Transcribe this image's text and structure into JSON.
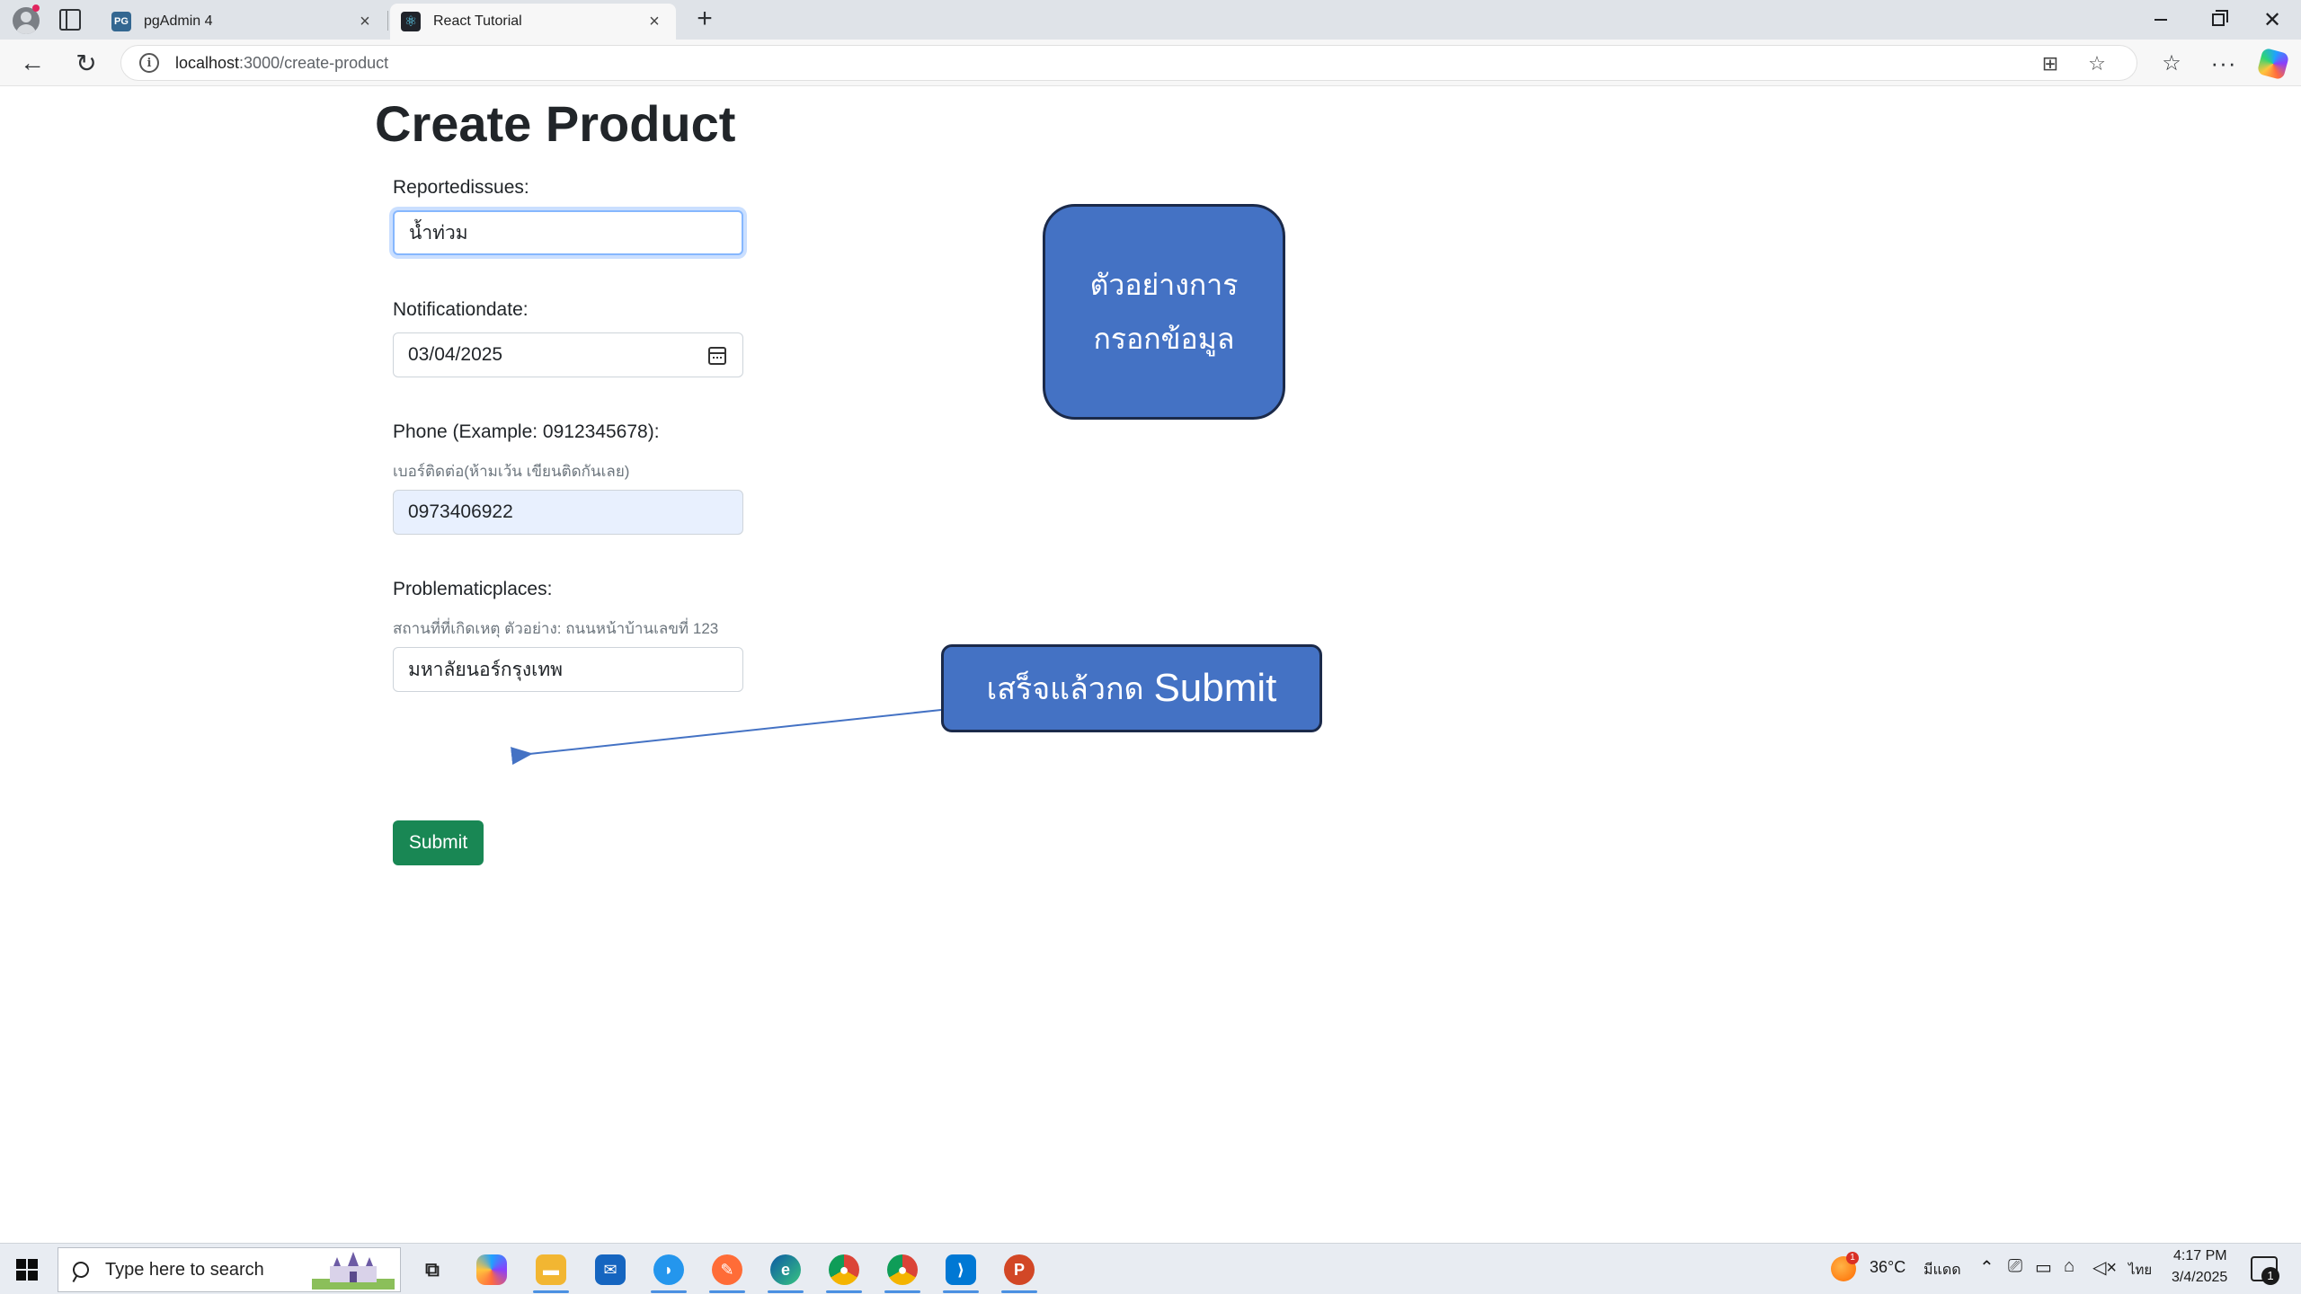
{
  "browser": {
    "tabs": [
      {
        "title": "pgAdmin 4",
        "favicon": "PG",
        "active": false
      },
      {
        "title": "React Tutorial",
        "favicon": "⚛",
        "active": true
      }
    ],
    "url_host": "localhost",
    "url_path": ":3000/create-product"
  },
  "page": {
    "title": "Create Product",
    "fields": [
      {
        "label": "Reportedissues:",
        "value": "น้ำท่วม"
      },
      {
        "label": "Notificationdate:",
        "value": "03/04/2025"
      },
      {
        "label": "Phone (Example: 0912345678):",
        "hint": "เบอร์ติดต่อ(ห้ามเว้น เขียนติดกันเลย)",
        "value": "0973406922"
      },
      {
        "label": "Problematicplaces:",
        "hint": "สถานที่ที่เกิดเหตุ ตัวอย่าง: ถนนหน้าบ้านเลขที่ 123",
        "value": "มหาลัยนอร์กรุงเทพ"
      }
    ],
    "submit_label": "Submit"
  },
  "annotations": {
    "example_callout_line1": "ตัวอย่างการ",
    "example_callout_line2": "กรอกข้อมูล",
    "submit_callout_thai": "เสร็จแล้วกด ",
    "submit_callout_en": "Submit",
    "callout_color": "#4472c4"
  },
  "taskbar": {
    "search_placeholder": "Type here to search",
    "apps": [
      "task-view",
      "copilot",
      "file-explorer",
      "mail",
      "docker",
      "postman",
      "edge",
      "chrome",
      "chrome-profile",
      "vscode",
      "powerpoint"
    ],
    "weather_temp": "36°C",
    "weather_desc": "มีแดด",
    "weather_badge": "1",
    "language": "ไทย",
    "time": "4:17 PM",
    "date": "3/4/2025",
    "notification_count": "1"
  }
}
